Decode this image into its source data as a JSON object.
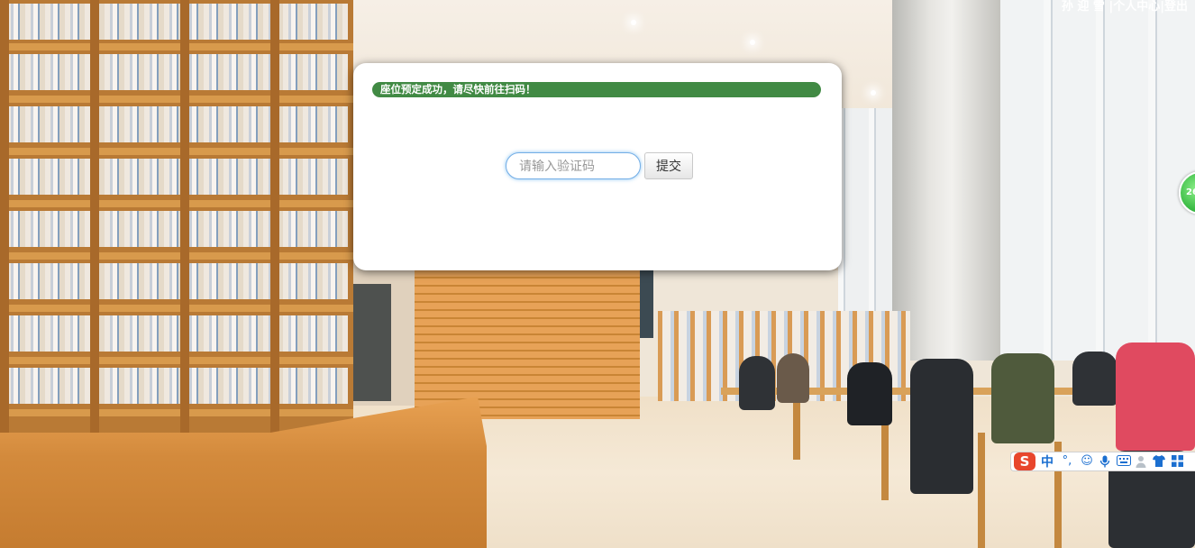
{
  "header": {
    "user_name": "孙 迎 雪",
    "sep1": "|",
    "personal_center": "个人中心",
    "sep2": "|",
    "logout": "登出"
  },
  "dialog": {
    "notice": "座位预定成功，请尽快前往扫码！",
    "input_placeholder": "请输入验证码",
    "input_value": "",
    "submit_label": "提交"
  },
  "floating_ball": {
    "text": "26"
  },
  "ime_toolbar": {
    "logo": "S",
    "mode": "中",
    "punct": "°,",
    "icons": [
      "smile-icon",
      "mic-icon",
      "keyboard-icon",
      "user-icon",
      "shirt-icon",
      "grid-icon"
    ]
  },
  "colors": {
    "notice_bg": "#418a44",
    "input_border": "#74aee6",
    "ime_accent": "#1b6fd0"
  }
}
